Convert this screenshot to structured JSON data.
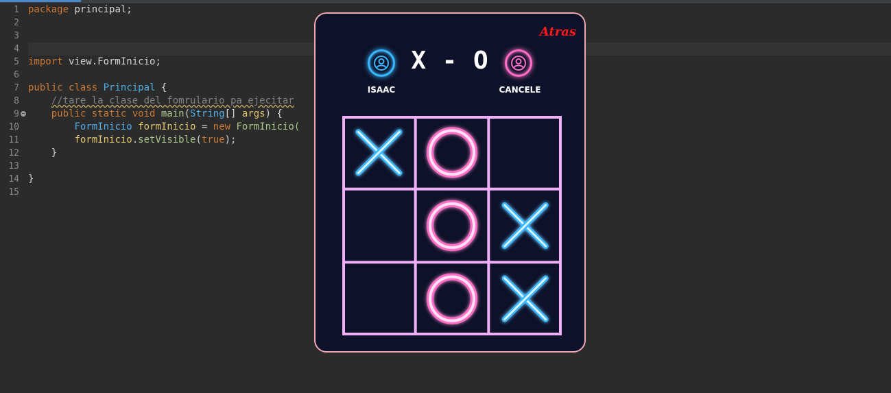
{
  "editor": {
    "line_numbers": [
      "1",
      "2",
      "3",
      "4",
      "5",
      "6",
      "7",
      "8",
      "9",
      "10",
      "11",
      "12",
      "13",
      "14",
      "15"
    ],
    "fold_marker_line": "9",
    "lines": [
      [
        {
          "t": "kw",
          "v": "package"
        },
        {
          "t": "pk",
          "v": " principal;"
        }
      ],
      [],
      [],
      [],
      [
        {
          "t": "kw",
          "v": "import"
        },
        {
          "t": "pk",
          "v": " view.FormInicio;"
        }
      ],
      [],
      [
        {
          "t": "kw",
          "v": "public"
        },
        {
          "t": "pn",
          "v": " "
        },
        {
          "t": "kw",
          "v": "class"
        },
        {
          "t": "pn",
          "v": " "
        },
        {
          "t": "cls",
          "v": "Principal"
        },
        {
          "t": "pn",
          "v": " {"
        }
      ],
      [
        {
          "t": "pn",
          "v": "    "
        },
        {
          "t": "cm",
          "v": "//tare la clase del fomrulario pa ejecitar"
        }
      ],
      [
        {
          "t": "pn",
          "v": "    "
        },
        {
          "t": "kw",
          "v": "public static void"
        },
        {
          "t": "pn",
          "v": " "
        },
        {
          "t": "fn",
          "v": "main"
        },
        {
          "t": "pn",
          "v": "("
        },
        {
          "t": "cls",
          "v": "String"
        },
        {
          "t": "pn",
          "v": "[] "
        },
        {
          "t": "var",
          "v": "args"
        },
        {
          "t": "pn",
          "v": ") {"
        }
      ],
      [
        {
          "t": "pn",
          "v": "        "
        },
        {
          "t": "cls",
          "v": "FormInicio"
        },
        {
          "t": "pn",
          "v": " "
        },
        {
          "t": "var",
          "v": "formInicio"
        },
        {
          "t": "pn",
          "v": " = "
        },
        {
          "t": "kw",
          "v": "new"
        },
        {
          "t": "pn",
          "v": " "
        },
        {
          "t": "fn",
          "v": "FormInicio("
        }
      ],
      [
        {
          "t": "pn",
          "v": "        "
        },
        {
          "t": "var",
          "v": "formInicio"
        },
        {
          "t": "pn",
          "v": "."
        },
        {
          "t": "fn",
          "v": "setVisible"
        },
        {
          "t": "pn",
          "v": "("
        },
        {
          "t": "kw",
          "v": "true"
        },
        {
          "t": "pn",
          "v": ");"
        }
      ],
      [
        {
          "t": "pn",
          "v": "    }"
        }
      ],
      [],
      [
        {
          "t": "pn",
          "v": "}"
        }
      ],
      []
    ],
    "current_line": "4"
  },
  "game": {
    "back_label": "Atras",
    "player1": {
      "name": "ISAAC",
      "icon": "user-circle-icon",
      "color": "#39b8ff"
    },
    "player2": {
      "name": "CANCELE",
      "icon": "user-circle-icon",
      "color": "#ff6ec7"
    },
    "score_text": "X - O",
    "board": [
      [
        "X",
        "O",
        ""
      ],
      [
        "",
        "O",
        "X"
      ],
      [
        "",
        "O",
        "X"
      ]
    ],
    "winning_line": {
      "orientation": "vertical",
      "column": 2
    },
    "colors": {
      "background": "#0d1129",
      "border": "#f0a8b0",
      "grid": "#f0b0f8",
      "x_mark": "#39b8ff",
      "o_mark": "#ff6ec7",
      "back_text": "#ff1a1a"
    }
  }
}
